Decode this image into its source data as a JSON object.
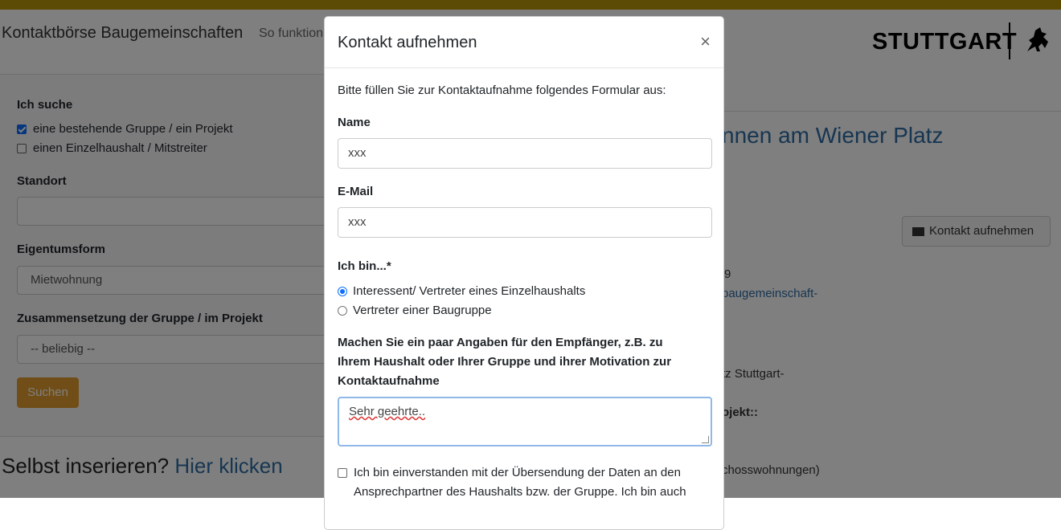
{
  "colors": {
    "topbar": "#b8960b",
    "accent": "#e39c2f",
    "link": "#2e6da4"
  },
  "header": {
    "brand": "Kontaktbörse Baugemeinschaften",
    "nav_item": "So funktion",
    "logo": "STUTTGART"
  },
  "filter": {
    "title": "Ich suche",
    "options": [
      {
        "label": "eine bestehende Gruppe / ein Projekt",
        "checked": true
      },
      {
        "label": "einen Einzelhaushalt / Mitstreiter",
        "checked": false
      }
    ],
    "standort_label": "Standort",
    "standort_value": "",
    "eigentum_label": "Eigentumsform",
    "eigentum_value": "Mietwohnung",
    "zusammen_label": "Zusammensetzung der Gruppe / im Projekt",
    "zusammen_value": "-- beliebig --",
    "search_button": "Suchen"
  },
  "self_insert": {
    "text": "Selbst inserieren? ",
    "link": "Hier klicken"
  },
  "right": {
    "title": "nnen am Wiener Platz",
    "contact_button": "Kontakt aufnehmen",
    "frag1": "9",
    "frag2": "baugemeinschaft-",
    "frag3": "tz Stuttgart-",
    "frag4": "ojekt::",
    "frag5": "chosswohnungen)"
  },
  "modal": {
    "title": "Kontakt aufnehmen",
    "close": "×",
    "intro": "Bitte füllen Sie zur Kontaktaufnahme folgendes Formular aus:",
    "name_label": "Name",
    "name_value": "xxx",
    "email_label": "E-Mail",
    "email_value": "xxx",
    "ichbin_label": "Ich bin...*",
    "radios": [
      {
        "label": "Interessent/ Vertreter eines Einzelhaushalts",
        "checked": true
      },
      {
        "label": "Vertreter einer Baugruppe",
        "checked": false
      }
    ],
    "message_label_1": "Machen Sie ein paar Angaben für den Empfänger, z.B. zu",
    "message_label_2": "Ihrem Haushalt oder Ihrer Gruppe und ihrer Motivation zur",
    "message_label_3": "Kontaktaufnahme",
    "message_value": "Sehr geehrte..",
    "consent_1": "Ich bin einverstanden mit der Übersendung der Daten an den",
    "consent_2": "Ansprechpartner des Haushalts bzw. der Gruppe. Ich bin auch"
  }
}
